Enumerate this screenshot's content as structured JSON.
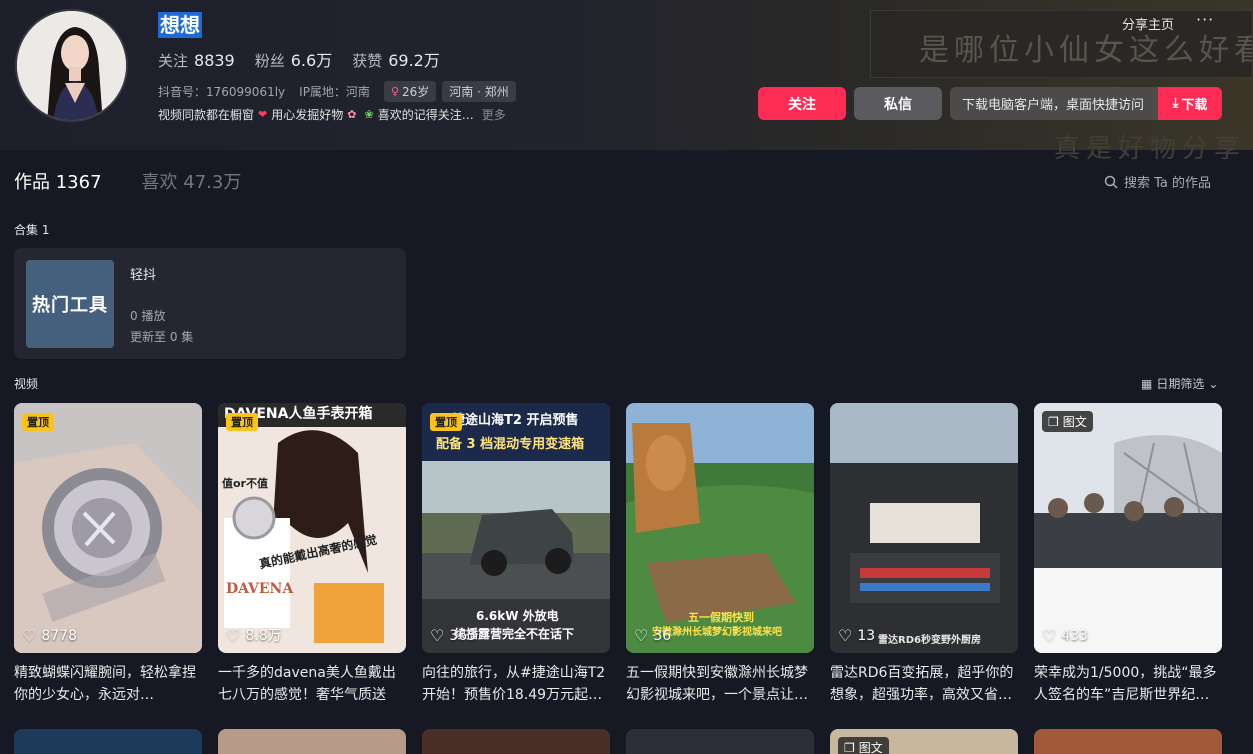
{
  "profile": {
    "name": "想想",
    "stats": [
      {
        "label": "关注",
        "value": "8839"
      },
      {
        "label": "粉丝",
        "value": "6.6万"
      },
      {
        "label": "获赞",
        "value": "69.2万"
      }
    ],
    "douyin_id": "抖音号：176099061ly",
    "ip": "IP属地：河南",
    "age": "26岁",
    "location": "河南 · 郑州",
    "bio_parts": [
      "视频同款都在橱窗",
      "用心发掘好物",
      "喜欢的记得关注…"
    ],
    "bio_more": "更多"
  },
  "header": {
    "share": "分享主页",
    "follow": "关注",
    "message": "私信",
    "download_text": "下载电脑客户端，桌面快捷访问",
    "download_btn": "下载",
    "banner_text": "是哪位小仙女这么好看",
    "banner_text2": "真是好物分享"
  },
  "tabs": {
    "works": "作品 1367",
    "likes": "喜欢 47.3万",
    "search": "搜索 Ta 的作品"
  },
  "collection": {
    "section_label": "合集 1",
    "cover_text": "热门工具",
    "title": "轻抖",
    "plays": "0 播放",
    "updated": "更新至 0 集"
  },
  "videos_section": {
    "label": "视频",
    "filter": "日期筛选"
  },
  "videos": [
    {
      "badge": "置顶",
      "likes": "8778",
      "caption": "精致蝴蝶闪耀腕间，轻松拿捏你的少女心，永远对…"
    },
    {
      "badge": "置顶",
      "likes": "8.8万",
      "caption": "一千多的davena美人鱼戴出七八万的感觉！奢华气质送人…",
      "overlay_top": "DAVENA人鱼手表开箱",
      "overlay_mid": "真的能戴出高奢的感觉",
      "overlay_side": "值or不值",
      "brand": "DAVENA"
    },
    {
      "badge": "置顶",
      "likes": "365",
      "caption": "向往的旅行，从#捷途山海T2开始！预售价18.49万元起…",
      "overlay_top": "捷途山海T2 开启预售",
      "overlay_sub": "配备 3 档混动专用变速箱",
      "overlay_bottom": "6.6kW 外放电",
      "overlay_bottom2": "续播露营完全不在话下"
    },
    {
      "badge": "",
      "likes": "36",
      "caption": "五一假期快到安徽滁州长城梦幻影视城来吧，一个景点让…",
      "overlay_bottom": "五一假期快到",
      "overlay_bottom2": "安徽滁州长城梦幻影视城来吧"
    },
    {
      "badge": "",
      "likes": "13",
      "caption": "雷达RD6百变拓展，超乎你的想象，超强功率，高效又省…",
      "overlay_bottom": "雷达RD6秒变野外厨房"
    },
    {
      "badge_img": "图文",
      "likes": "433",
      "caption": "荣幸成为1/5000，挑战“最多人签名的车”吉尼斯世界纪…"
    }
  ],
  "second_row_badge": "图文",
  "colors": {
    "accent": "#fe2c55",
    "background": "#161823",
    "pin_badge": "#fbc31a"
  }
}
